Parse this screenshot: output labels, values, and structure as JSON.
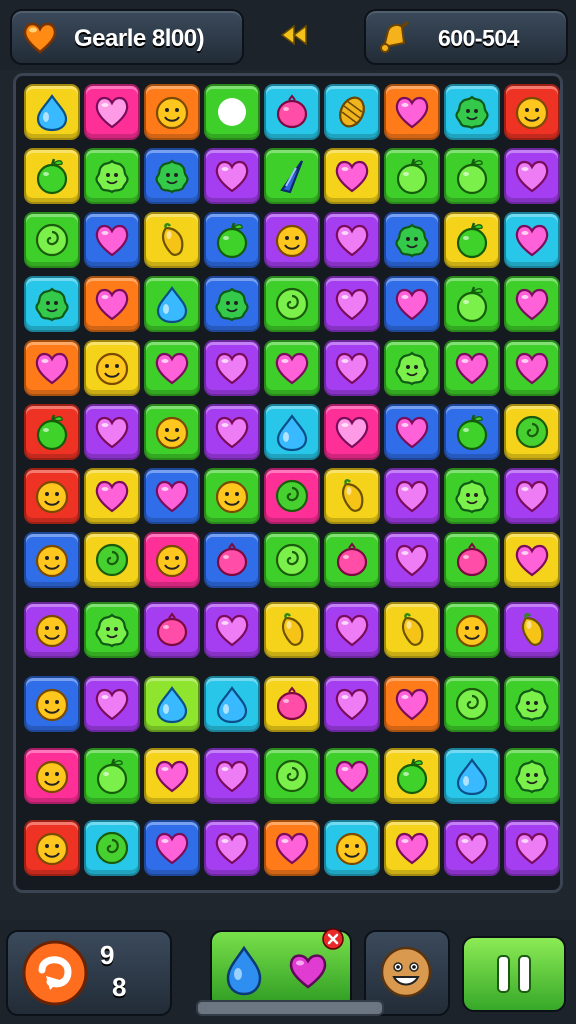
{
  "hud": {
    "left_label": "Gearle 8l00)",
    "right_label": "600-504",
    "left_icon": "heart-icon",
    "right_icon": "bell-icon",
    "center_icon": "double-arrow-icon"
  },
  "palette": {
    "yellow": "#f5d31a",
    "pink": "#ff2f98",
    "orange": "#ff7b1a",
    "green": "#3fcf2a",
    "cyan": "#28c7ea",
    "purple": "#a53ef0",
    "red": "#ee3324",
    "blue": "#2f6ee8",
    "lime": "#8fe42d"
  },
  "board": {
    "rows": [
      [
        {
          "bg": "yellow",
          "s": "drop"
        },
        {
          "bg": "pink",
          "s": "heart"
        },
        {
          "bg": "orange",
          "s": "face"
        },
        {
          "bg": "green",
          "s": "leaf"
        },
        {
          "bg": "cyan",
          "s": "berry"
        },
        {
          "bg": "cyan",
          "s": "corn"
        },
        {
          "bg": "orange",
          "s": "heart"
        },
        {
          "bg": "cyan",
          "s": "blob"
        },
        {
          "bg": "red",
          "s": "face"
        }
      ],
      [
        {
          "bg": "yellow",
          "s": "apple"
        },
        {
          "bg": "green",
          "s": "blob"
        },
        {
          "bg": "blue",
          "s": "blob"
        },
        {
          "bg": "purple",
          "s": "heart"
        },
        {
          "bg": "green",
          "s": "cone"
        },
        {
          "bg": "yellow",
          "s": "heart"
        },
        {
          "bg": "green",
          "s": "apple"
        },
        {
          "bg": "green",
          "s": "apple"
        },
        {
          "bg": "purple",
          "s": "heart"
        }
      ],
      [
        {
          "bg": "green",
          "s": "swirl"
        },
        {
          "bg": "blue",
          "s": "heart"
        },
        {
          "bg": "yellow",
          "s": "pepper"
        },
        {
          "bg": "blue",
          "s": "apple"
        },
        {
          "bg": "purple",
          "s": "face"
        },
        {
          "bg": "purple",
          "s": "heart"
        },
        {
          "bg": "blue",
          "s": "blob"
        },
        {
          "bg": "yellow",
          "s": "apple"
        },
        {
          "bg": "cyan",
          "s": "heart"
        }
      ],
      [
        {
          "bg": "cyan",
          "s": "blob"
        },
        {
          "bg": "orange",
          "s": "heart"
        },
        {
          "bg": "green",
          "s": "drop"
        },
        {
          "bg": "blue",
          "s": "blob"
        },
        {
          "bg": "green",
          "s": "swirl"
        },
        {
          "bg": "purple",
          "s": "heart"
        },
        {
          "bg": "blue",
          "s": "heart"
        },
        {
          "bg": "green",
          "s": "apple"
        },
        {
          "bg": "green",
          "s": "heart"
        }
      ],
      [
        {
          "bg": "orange",
          "s": "heart"
        },
        {
          "bg": "yellow",
          "s": "face"
        },
        {
          "bg": "green",
          "s": "heart"
        },
        {
          "bg": "purple",
          "s": "heart"
        },
        {
          "bg": "green",
          "s": "heart"
        },
        {
          "bg": "purple",
          "s": "heart"
        },
        {
          "bg": "green",
          "s": "blob"
        },
        {
          "bg": "green",
          "s": "heart"
        },
        {
          "bg": "green",
          "s": "heart"
        }
      ],
      [
        {
          "bg": "red",
          "s": "apple"
        },
        {
          "bg": "purple",
          "s": "heart"
        },
        {
          "bg": "green",
          "s": "face"
        },
        {
          "bg": "purple",
          "s": "heart"
        },
        {
          "bg": "cyan",
          "s": "drop"
        },
        {
          "bg": "pink",
          "s": "heart"
        },
        {
          "bg": "blue",
          "s": "heart"
        },
        {
          "bg": "blue",
          "s": "apple"
        },
        {
          "bg": "yellow",
          "s": "swirl"
        }
      ],
      [
        {
          "bg": "red",
          "s": "face"
        },
        {
          "bg": "yellow",
          "s": "heart"
        },
        {
          "bg": "blue",
          "s": "heart"
        },
        {
          "bg": "green",
          "s": "face"
        },
        {
          "bg": "pink",
          "s": "swirl"
        },
        {
          "bg": "yellow",
          "s": "pepper"
        },
        {
          "bg": "purple",
          "s": "heart"
        },
        {
          "bg": "green",
          "s": "blob"
        },
        {
          "bg": "purple",
          "s": "heart"
        }
      ],
      [
        {
          "bg": "blue",
          "s": "face"
        },
        {
          "bg": "yellow",
          "s": "swirl"
        },
        {
          "bg": "pink",
          "s": "face"
        },
        {
          "bg": "blue",
          "s": "berry"
        },
        {
          "bg": "green",
          "s": "swirl"
        },
        {
          "bg": "green",
          "s": "berry"
        },
        {
          "bg": "purple",
          "s": "heart"
        },
        {
          "bg": "green",
          "s": "berry"
        },
        {
          "bg": "yellow",
          "s": "heart"
        }
      ],
      [
        {
          "bg": "purple",
          "s": "face"
        },
        {
          "bg": "green",
          "s": "blob"
        },
        {
          "bg": "purple",
          "s": "berry"
        },
        {
          "bg": "purple",
          "s": "heart"
        },
        {
          "bg": "yellow",
          "s": "pepper"
        },
        {
          "bg": "purple",
          "s": "heart"
        },
        {
          "bg": "yellow",
          "s": "pepper"
        },
        {
          "bg": "green",
          "s": "face"
        },
        {
          "bg": "purple",
          "s": "pepper"
        }
      ],
      [
        {
          "bg": "blue",
          "s": "face"
        },
        {
          "bg": "purple",
          "s": "heart"
        },
        {
          "bg": "lime",
          "s": "drop"
        },
        {
          "bg": "cyan",
          "s": "drop"
        },
        {
          "bg": "yellow",
          "s": "berry"
        },
        {
          "bg": "purple",
          "s": "heart"
        },
        {
          "bg": "orange",
          "s": "heart"
        },
        {
          "bg": "green",
          "s": "swirl"
        },
        {
          "bg": "green",
          "s": "blob"
        }
      ],
      [
        {
          "bg": "pink",
          "s": "face"
        },
        {
          "bg": "green",
          "s": "apple"
        },
        {
          "bg": "yellow",
          "s": "heart"
        },
        {
          "bg": "purple",
          "s": "heart"
        },
        {
          "bg": "green",
          "s": "swirl"
        },
        {
          "bg": "green",
          "s": "heart"
        },
        {
          "bg": "yellow",
          "s": "apple"
        },
        {
          "bg": "cyan",
          "s": "drop"
        },
        {
          "bg": "green",
          "s": "blob"
        }
      ],
      [
        {
          "bg": "red",
          "s": "face"
        },
        {
          "bg": "cyan",
          "s": "swirl"
        },
        {
          "bg": "blue",
          "s": "heart"
        },
        {
          "bg": "purple",
          "s": "heart"
        },
        {
          "bg": "orange",
          "s": "heart"
        },
        {
          "bg": "cyan",
          "s": "face"
        },
        {
          "bg": "yellow",
          "s": "heart"
        },
        {
          "bg": "purple",
          "s": "heart"
        },
        {
          "bg": "purple",
          "s": "heart"
        }
      ]
    ]
  },
  "bottom": {
    "moves_top": "9",
    "moves_bottom": "8",
    "moves_icon": "undo-arrow-icon",
    "boost_icons": [
      "drop-icon",
      "heart-icon",
      "close-badge-icon"
    ],
    "face_icon": "face-icon",
    "pause_icon": "pause-icon"
  }
}
